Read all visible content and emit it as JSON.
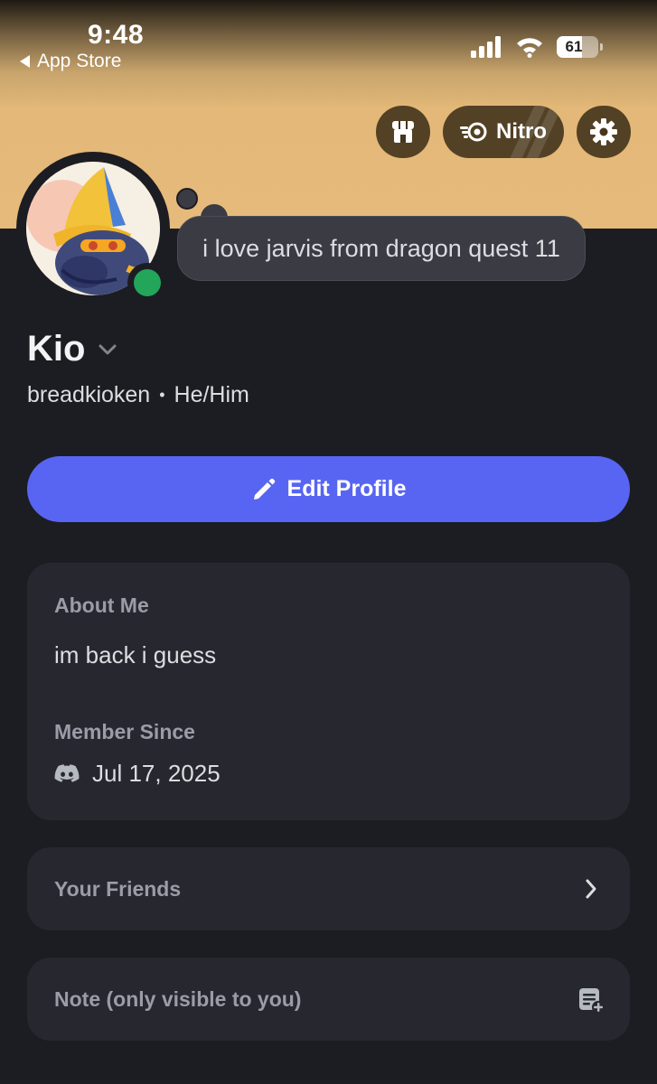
{
  "status_bar": {
    "time": "9:48",
    "back_label": "App Store",
    "battery": "61",
    "battery_level": 0.61
  },
  "header_buttons": {
    "shop_icon": "shop-icon",
    "nitro_label": "Nitro",
    "settings_icon": "gear-icon"
  },
  "profile": {
    "custom_status": "i love jarvis from dragon quest 11",
    "display_name": "Kio",
    "username": "breadkioken",
    "separator": "•",
    "pronouns": "He/Him",
    "presence": "online",
    "presence_color": "#23a55a"
  },
  "edit_profile": {
    "label": "Edit Profile",
    "icon": "pencil-icon"
  },
  "about": {
    "heading": "About Me",
    "text": "im back i guess",
    "member_since_heading": "Member Since",
    "member_since_date": "Jul 17, 2025",
    "member_icon": "discord-icon"
  },
  "friends": {
    "label": "Your Friends"
  },
  "note": {
    "label": "Note (only visible to you)"
  },
  "colors": {
    "banner": "#e6ba7a",
    "background": "#1c1d22",
    "card": "#27282f",
    "accent": "#5865f2"
  }
}
